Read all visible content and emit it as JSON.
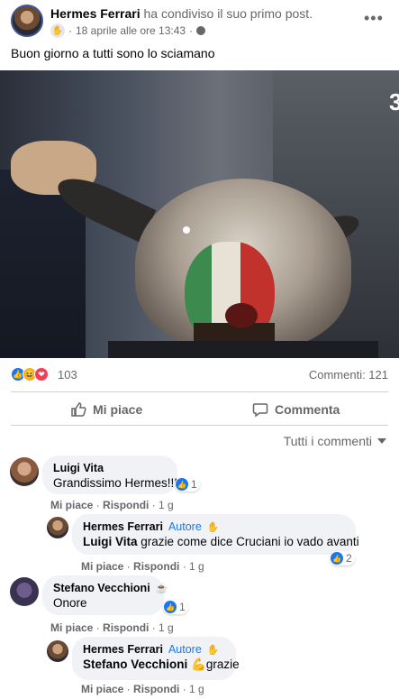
{
  "post": {
    "author": "Hermes Ferrari",
    "action": "ha condiviso il suo primo post.",
    "timestamp": "18 aprile alle ore 13:43",
    "more_icon": "more-horizontal-icon",
    "text": "Buon giorno a tutti sono lo sciamano",
    "photo_overlay_char": "3"
  },
  "stats": {
    "reaction_icons": [
      "like-icon",
      "haha-icon",
      "love-icon"
    ],
    "reaction_count": "103",
    "comments_label": "Commenti: 121"
  },
  "actions": {
    "like_label": "Mi piace",
    "comment_label": "Commenta"
  },
  "sort": {
    "label": "Tutti i commenti"
  },
  "comments": [
    {
      "name": "Luigi Vita",
      "text": "Grandissimo Hermes!!!",
      "reactions": "1",
      "like": "Mi piace",
      "reply": "Rispondi",
      "time": "1 g"
    },
    {
      "name": "Hermes Ferrari",
      "badge": "Autore",
      "mention": "Luigi Vita",
      "text": "grazie come dice Cruciani io vado avanti",
      "reactions": "2",
      "like": "Mi piace",
      "reply": "Rispondi",
      "time": "1 g"
    },
    {
      "name": "Stefano Vecchioni",
      "text": "Onore",
      "reactions": "1",
      "like": "Mi piace",
      "reply": "Rispondi",
      "time": "1 g"
    },
    {
      "name": "Hermes Ferrari",
      "badge": "Autore",
      "mention": "Stefano Vecchioni",
      "text": "💪grazie",
      "like": "Mi piace",
      "reply": "Rispondi",
      "time": "1 g"
    }
  ],
  "colors": {
    "accent": "#1877f2",
    "secondary_text": "#65676b",
    "bubble_bg": "#f0f2f5"
  }
}
